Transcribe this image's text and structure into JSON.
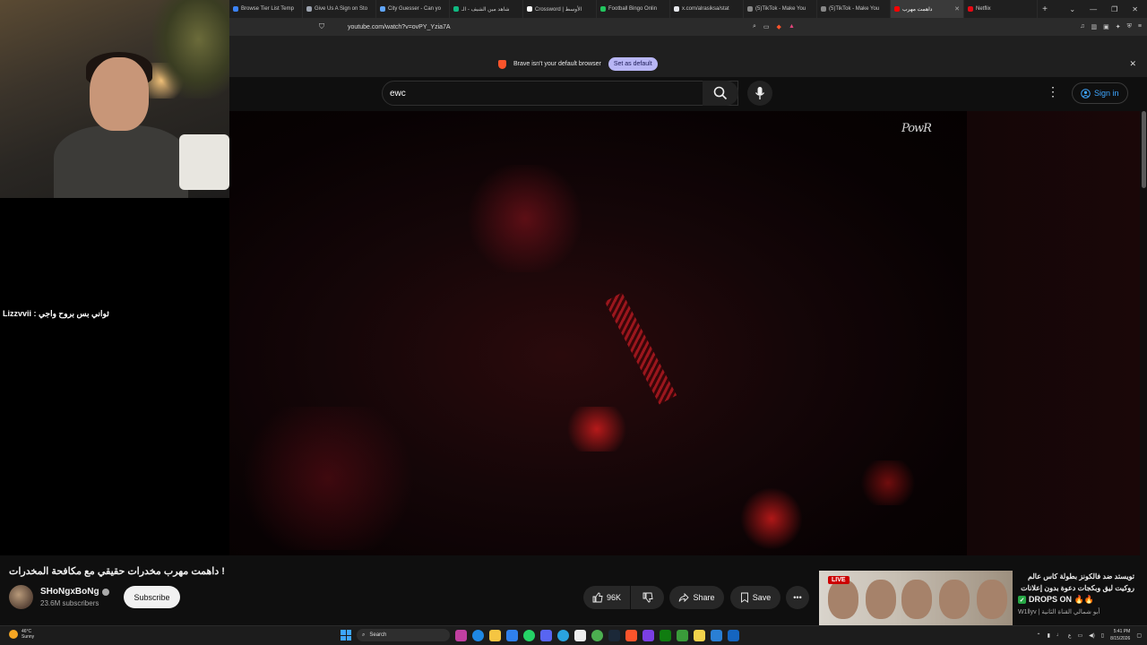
{
  "browser": {
    "tabs": [
      {
        "label": "Browse Tier List Temp",
        "color": "#3b82f6",
        "active": false
      },
      {
        "label": "Give Us A Sign on Sto",
        "color": "#9ca3af",
        "active": false
      },
      {
        "label": "City Guesser - Can yo",
        "color": "#60a5fa",
        "active": false
      },
      {
        "label": "شاهد مين الشيف - الـ",
        "color": "#10b981",
        "active": false
      },
      {
        "label": "Crossword | الأوسط",
        "color": "#ffffff",
        "active": false
      },
      {
        "label": "Football Bingo Onlin",
        "color": "#22c55e",
        "active": false
      },
      {
        "label": "x.com/alrasiksa/stat",
        "color": "#e5e7eb",
        "active": false
      },
      {
        "label": "(5)TikTok - Make You",
        "color": "#111111",
        "active": false
      },
      {
        "label": "(5)TikTok - Make You",
        "color": "#111111",
        "active": false
      },
      {
        "label": "داهمت مهرب",
        "color": "#ff0000",
        "active": true
      },
      {
        "label": "Netflix",
        "color": "#e50914",
        "active": false
      }
    ],
    "new_tab": "+",
    "address": "youtube.com/watch?v=ovPY_Yzia7A",
    "notice": {
      "text": "Brave isn't your default browser",
      "button": "Set as default"
    }
  },
  "youtube": {
    "search_query": "ewc",
    "sign_in": "Sign in",
    "watermark": "PowR"
  },
  "stream_overlay": {
    "chat_message": "Lizzvvii : ثواني بس بروح واجي"
  },
  "video": {
    "title": "داهمت مهرب مخدرات حقيقي مع مكافحة المخدرات !",
    "channel": "SHoNgxBoNg",
    "subscribers": "23.6M subscribers",
    "subscribe": "Subscribe",
    "likes": "96K",
    "share": "Share",
    "save": "Save"
  },
  "sidebar_ad": {
    "live_badge": "LIVE",
    "title": "تويستد ضد فالكونز بطولة كاس عالم روكيت ليق وبكجات دعوة بدون إعلانات",
    "drops": "DROPS ON 🔥🔥",
    "channel": "W1llyv | أبو شمالي القناة الثانية"
  },
  "taskbar": {
    "temperature": "46°C",
    "weather": "Sunny",
    "search": "Search",
    "time": "5:41 PM",
    "date": "8/15/2026",
    "lang": "ع",
    "icons": [
      "copilot-icon",
      "edge-icon",
      "explorer-icon",
      "notepad-icon",
      "whatsapp-icon",
      "discord-icon",
      "telegram-icon",
      "capcut-icon",
      "chrome-icon",
      "steam-icon",
      "brave-icon",
      "store-icon",
      "xbox-icon",
      "gamepass-icon",
      "files-icon",
      "vscode-icon",
      "app-icon"
    ]
  }
}
